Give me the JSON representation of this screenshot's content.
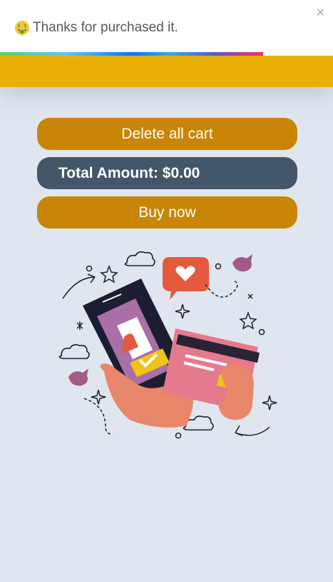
{
  "toast": {
    "icon": "money-mouth-face-icon",
    "message": "Thanks for purchased it.",
    "close_symbol": "×",
    "progress_remaining": 0.79,
    "progress_colors": [
      "#4cd964",
      "#5ac8fa",
      "#007aff",
      "#5856d6",
      "#ff2d55"
    ]
  },
  "header": {
    "color": "#e8b007"
  },
  "cart": {
    "delete_label": "Delete all cart",
    "total_label": "Total Amount: $0.00",
    "buy_label": "Buy now"
  },
  "illustration": {
    "icon": "mobile-shopping-payment-illustration"
  },
  "colors": {
    "page_bg": "#e0e6ef",
    "button_gold": "#c98506",
    "total_bg": "#445669"
  }
}
